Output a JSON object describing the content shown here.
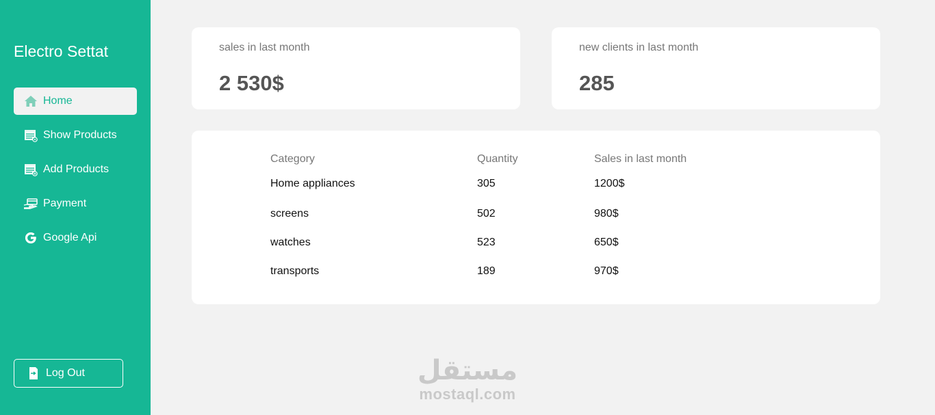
{
  "app": {
    "brand": "Electro Settat"
  },
  "colors": {
    "accent": "#16b795",
    "background": "#f2f2f2",
    "card": "#ffffff"
  },
  "sidebar": {
    "items": [
      {
        "label": "Home",
        "icon": "home-icon",
        "active": true
      },
      {
        "label": "Show Products",
        "icon": "product-list-view-icon",
        "active": false
      },
      {
        "label": "Add Products",
        "icon": "product-list-add-icon",
        "active": false
      },
      {
        "label": "Payment",
        "icon": "payment-hand-icon",
        "active": false
      },
      {
        "label": "Google Api",
        "icon": "google-icon",
        "active": false
      }
    ],
    "logout": {
      "label": "Log Out",
      "icon": "logout-icon"
    }
  },
  "stats": [
    {
      "label": "sales in last month",
      "value": "2 530$"
    },
    {
      "label": "new clients in last month",
      "value": "285"
    }
  ],
  "table": {
    "headers": [
      "Category",
      "Quantity",
      "Sales in last month"
    ],
    "rows": [
      [
        "Home appliances",
        "305",
        "1200$"
      ],
      [
        "screens",
        "502",
        "980$"
      ],
      [
        "watches",
        "523",
        "650$"
      ],
      [
        "transports",
        "189",
        "970$"
      ]
    ]
  },
  "watermark": {
    "arabic": "مستقل",
    "latin": "mostaql.com"
  }
}
